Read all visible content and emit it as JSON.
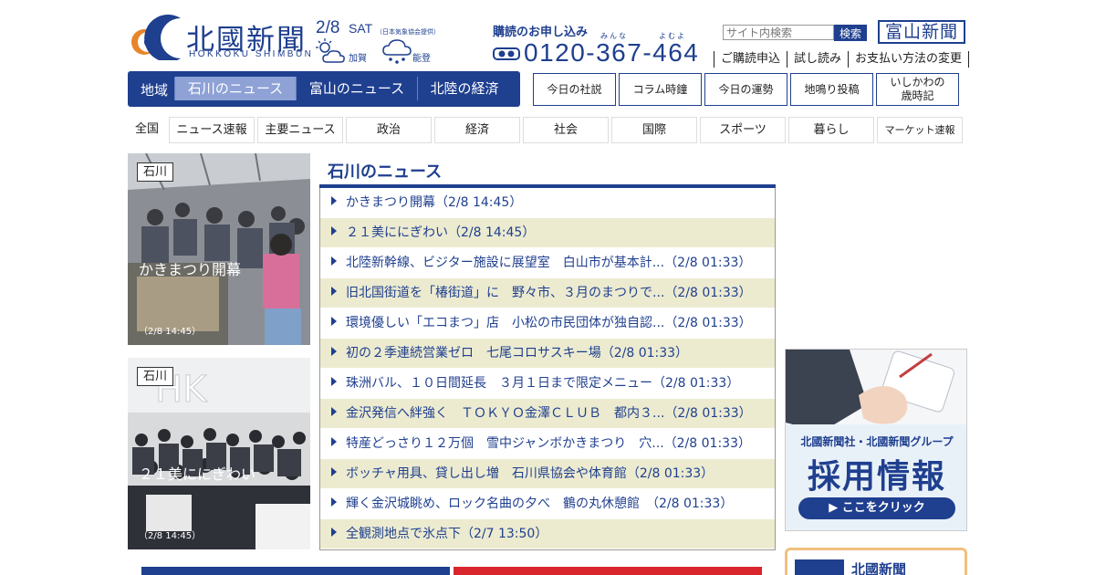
{
  "header": {
    "logo_jp": "北國新聞",
    "logo_en": "HOKKOKU SHIMBUN",
    "date": "2/8",
    "weekday": "SAT",
    "weather_source": "（日本気象協会提供）",
    "weather": [
      {
        "area": "加賀",
        "icon": "cloud-sun-icon"
      },
      {
        "area": "能登",
        "icon": "cloud-snow-icon"
      }
    ],
    "subscribe_title": "購読のお申し込み",
    "subscribe_ruby_1": "みんな",
    "subscribe_ruby_2": "よむよ",
    "phone": "0120-367-464",
    "search_placeholder": "サイト内検索",
    "search_button": "検索",
    "toyama_link": "富山新聞",
    "links": [
      "ご購読申込",
      "試し読み",
      "お支払い方法の変更"
    ]
  },
  "region_nav": {
    "label": "地域",
    "tabs": [
      {
        "label": "石川のニュース",
        "active": true
      },
      {
        "label": "富山のニュース",
        "active": false
      },
      {
        "label": "北陸の経済",
        "active": false
      }
    ]
  },
  "quick_buttons": [
    "今日の社説",
    "コラム時鐘",
    "今日の運勢",
    "地鳴り投稿",
    "いしかわの\n歳時記"
  ],
  "category_nav": [
    "全国",
    "ニュース速報",
    "主要ニュース",
    "政治",
    "経済",
    "社会",
    "国際",
    "スポーツ",
    "暮らし",
    "マーケット速報"
  ],
  "featured": [
    {
      "tag": "石川",
      "caption": "かきまつり開幕",
      "time": "（2/8 14:45）"
    },
    {
      "tag": "石川",
      "caption": "２１美ににぎわい",
      "time": "（2/8 14:45）"
    }
  ],
  "news": {
    "title": "石川のニュース",
    "items": [
      "かきまつり開幕（2/8 14:45）",
      "２１美ににぎわい（2/8 14:45）",
      "北陸新幹線、ビジター施設に展望室　白山市が基本計...（2/8 01:33）",
      "旧北国街道を「椿街道」に　野々市、３月のまつりで...（2/8 01:33）",
      "環境優しい「エコまつ」店　小松の市民団体が独自認...（2/8 01:33）",
      "初の２季連続営業ゼロ　七尾コロサスキー場（2/8 01:33）",
      "珠洲バル、１０日間延長　３月１日まで限定メニュー（2/8 01:33）",
      "金沢発信へ絆強く　ＴＯＫＹＯ金澤ＣＬＵＢ　都内３...（2/8 01:33）",
      "特産どっさり１２万個　雪中ジャンボかきまつり　穴...（2/8 01:33）",
      "ボッチャ用具、貸し出し増　石川県協会や体育館（2/8 01:33）",
      "輝く金沢城眺め、ロック名曲の夕べ　鶴の丸休憩館　（2/8 01:33）",
      "全観測地点で氷点下（2/7 13:50）"
    ]
  },
  "recruit_ad": {
    "line1": "北國新聞社・北國新聞グループ",
    "line2": "採用情報",
    "button": "▶ ここをクリック"
  },
  "promo": {
    "text": "北國新聞"
  },
  "colors": {
    "brand": "#1f3f8f",
    "stripe": "#ecebd0",
    "active_tab": "#8ea2d6"
  }
}
